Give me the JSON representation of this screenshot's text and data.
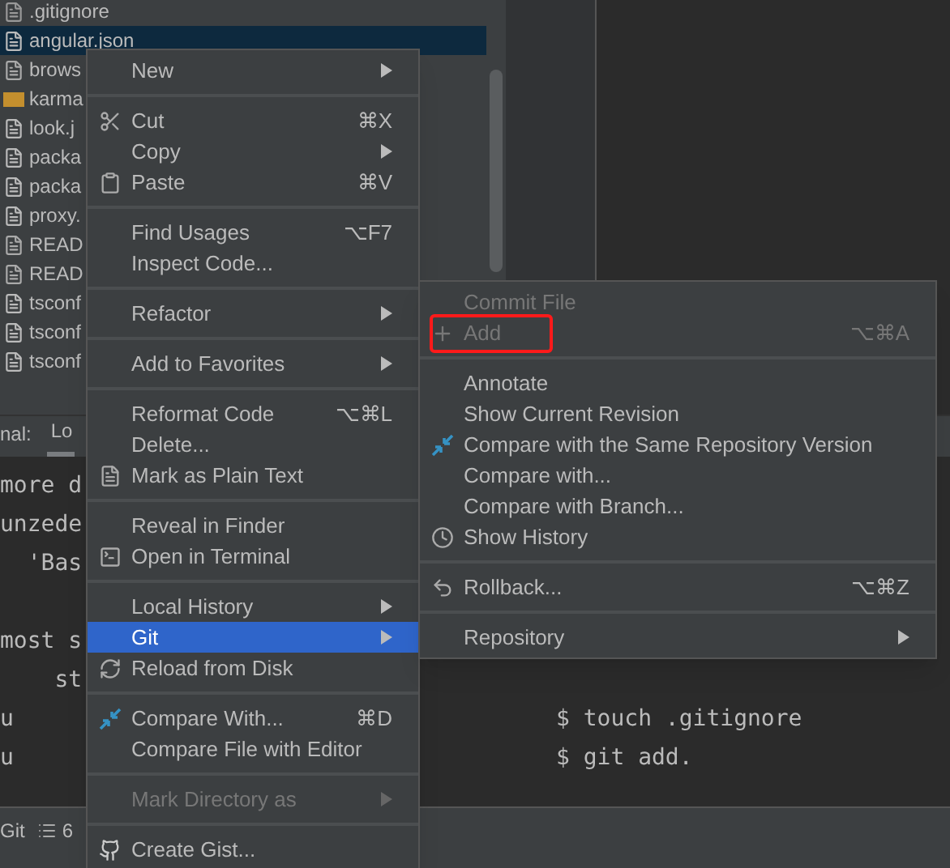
{
  "project_tree": {
    "files": [
      {
        "name": ".gitignore",
        "kind": "ignore",
        "selected": false
      },
      {
        "name": "angular.json",
        "kind": "json",
        "selected": true
      },
      {
        "name": "brows",
        "kind": "text",
        "selected": false
      },
      {
        "name": "karma",
        "kind": "js",
        "selected": false
      },
      {
        "name": "look.j",
        "kind": "json",
        "selected": false
      },
      {
        "name": "packa",
        "kind": "json",
        "selected": false
      },
      {
        "name": "packa",
        "kind": "json",
        "selected": false
      },
      {
        "name": "proxy.",
        "kind": "json",
        "selected": false
      },
      {
        "name": "READ",
        "kind": "text",
        "selected": false
      },
      {
        "name": "READ",
        "kind": "text",
        "selected": false
      },
      {
        "name": "tsconf",
        "kind": "json",
        "selected": false
      },
      {
        "name": "tsconf",
        "kind": "json",
        "selected": false
      },
      {
        "name": "tsconf",
        "kind": "json",
        "selected": false
      }
    ]
  },
  "terminal": {
    "tab_label": "nal:",
    "tabs": [
      {
        "label": "Lo",
        "selected": true
      }
    ],
    "lines": [
      {
        "kind": "text",
        "left": "more d"
      },
      {
        "kind": "text",
        "left": "unzede"
      },
      {
        "kind": "text",
        "left": "  'Bas"
      },
      {
        "kind": "blank"
      },
      {
        "kind": "text",
        "left": "most s"
      },
      {
        "kind": "text",
        "left": "    st"
      },
      {
        "kind": "text",
        "left": "u",
        "right": "$ touch .gitignore"
      },
      {
        "kind": "text",
        "left": "u",
        "right": "$ git add."
      }
    ]
  },
  "status_bar": {
    "items": [
      "Git",
      "6"
    ]
  },
  "context_menu": {
    "items": [
      {
        "kind": "item",
        "label": "New",
        "submenu": true,
        "disabled": false,
        "selected": false
      },
      {
        "kind": "separator"
      },
      {
        "kind": "item",
        "label": "Cut",
        "shortcut": "⌘X",
        "submenu": false,
        "disabled": false,
        "selected": false
      },
      {
        "kind": "item",
        "label": "Copy",
        "submenu": true,
        "disabled": false,
        "selected": false
      },
      {
        "kind": "item",
        "label": "Paste",
        "shortcut": "⌘V",
        "submenu": false,
        "disabled": false,
        "selected": false
      },
      {
        "kind": "separator"
      },
      {
        "kind": "item",
        "label": "Find Usages",
        "shortcut": "⌥F7",
        "submenu": false,
        "disabled": false,
        "selected": false
      },
      {
        "kind": "item",
        "label": "Inspect Code...",
        "submenu": false,
        "disabled": false,
        "selected": false
      },
      {
        "kind": "separator"
      },
      {
        "kind": "item",
        "label": "Refactor",
        "submenu": true,
        "disabled": false,
        "selected": false
      },
      {
        "kind": "separator"
      },
      {
        "kind": "item",
        "label": "Add to Favorites",
        "submenu": true,
        "disabled": false,
        "selected": false
      },
      {
        "kind": "separator"
      },
      {
        "kind": "item",
        "label": "Reformat Code",
        "shortcut": "⌥⌘L",
        "submenu": false,
        "disabled": false,
        "selected": false
      },
      {
        "kind": "item",
        "label": "Delete...",
        "submenu": false,
        "disabled": false,
        "selected": false
      },
      {
        "kind": "item",
        "label": "Mark as Plain Text",
        "submenu": false,
        "disabled": false,
        "selected": false
      },
      {
        "kind": "separator"
      },
      {
        "kind": "item",
        "label": "Reveal in Finder",
        "submenu": false,
        "disabled": false,
        "selected": false
      },
      {
        "kind": "item",
        "label": "Open in Terminal",
        "submenu": false,
        "disabled": false,
        "selected": false
      },
      {
        "kind": "separator"
      },
      {
        "kind": "item",
        "label": "Local History",
        "submenu": true,
        "disabled": false,
        "selected": false
      },
      {
        "kind": "item",
        "label": "Git",
        "submenu": true,
        "disabled": false,
        "selected": true
      },
      {
        "kind": "item",
        "label": "Reload from Disk",
        "submenu": false,
        "disabled": false,
        "selected": false
      },
      {
        "kind": "separator"
      },
      {
        "kind": "item",
        "label": "Compare With...",
        "shortcut": "⌘D",
        "submenu": false,
        "disabled": false,
        "selected": false
      },
      {
        "kind": "item",
        "label": "Compare File with Editor",
        "submenu": false,
        "disabled": false,
        "selected": false
      },
      {
        "kind": "separator"
      },
      {
        "kind": "item",
        "label": "Mark Directory as",
        "submenu": true,
        "disabled": true,
        "selected": false
      },
      {
        "kind": "separator"
      },
      {
        "kind": "item",
        "label": "Create Gist...",
        "submenu": false,
        "disabled": false,
        "selected": false
      }
    ]
  },
  "git_submenu": {
    "items": [
      {
        "kind": "item",
        "label": "Commit File",
        "submenu": false,
        "disabled": true,
        "highlighted": false
      },
      {
        "kind": "item",
        "label": "Add",
        "shortcut": "⌥⌘A",
        "submenu": false,
        "disabled": true,
        "highlighted": true
      },
      {
        "kind": "separator"
      },
      {
        "kind": "item",
        "label": "Annotate",
        "submenu": false,
        "disabled": false,
        "highlighted": false
      },
      {
        "kind": "item",
        "label": "Show Current Revision",
        "submenu": false,
        "disabled": false,
        "highlighted": false
      },
      {
        "kind": "item",
        "label": "Compare with the Same Repository Version",
        "submenu": false,
        "disabled": false,
        "highlighted": false
      },
      {
        "kind": "item",
        "label": "Compare with...",
        "submenu": false,
        "disabled": false,
        "highlighted": false
      },
      {
        "kind": "item",
        "label": "Compare with Branch...",
        "submenu": false,
        "disabled": false,
        "highlighted": false
      },
      {
        "kind": "item",
        "label": "Show History",
        "submenu": false,
        "disabled": false,
        "highlighted": false
      },
      {
        "kind": "separator"
      },
      {
        "kind": "item",
        "label": "Rollback...",
        "shortcut": "⌥⌘Z",
        "submenu": false,
        "disabled": false,
        "highlighted": false
      },
      {
        "kind": "separator"
      },
      {
        "kind": "item",
        "label": "Repository",
        "submenu": true,
        "disabled": false,
        "highlighted": false
      }
    ]
  }
}
